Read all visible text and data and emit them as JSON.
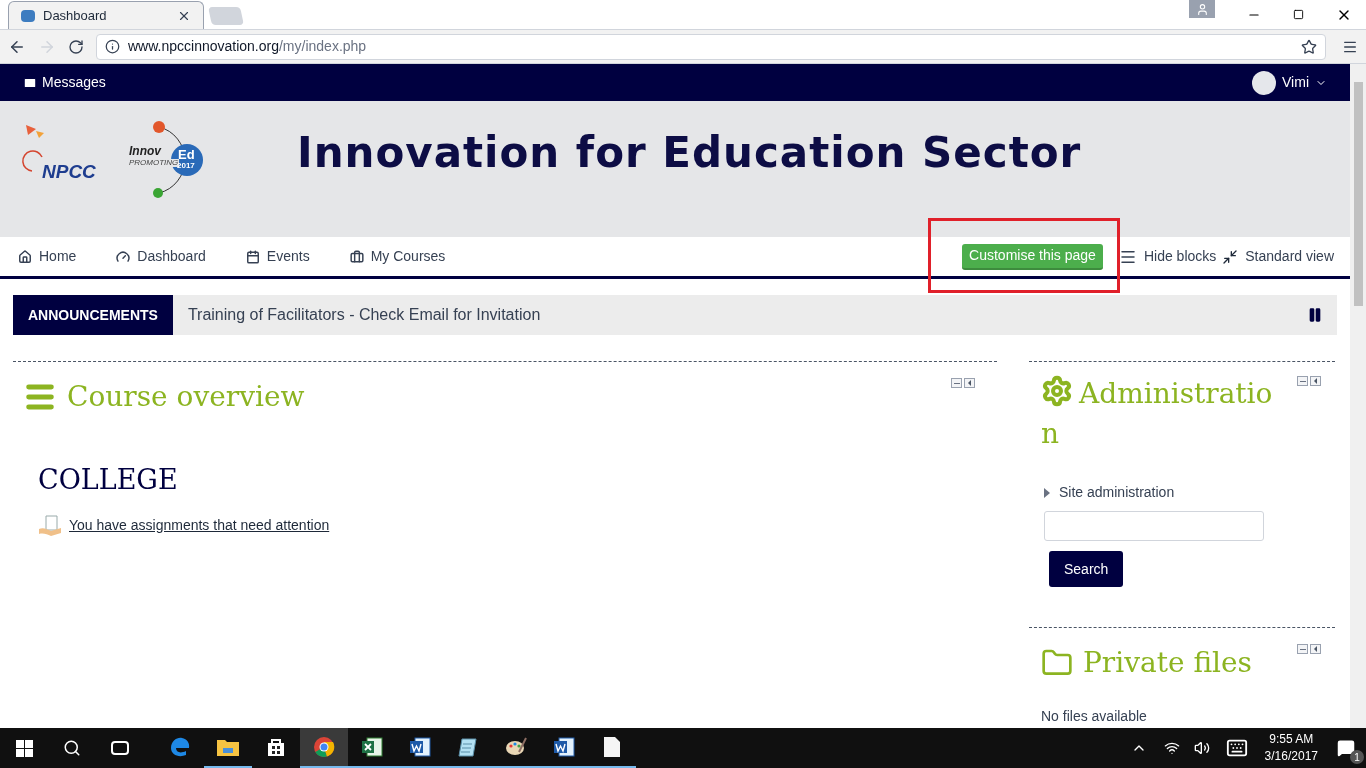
{
  "browser": {
    "tabs": [
      {
        "title": "Dashboard",
        "selected": true
      }
    ],
    "url_host": "www.npccinnovation.org",
    "url_path": "/my/index.php"
  },
  "topbar": {
    "messages": "Messages",
    "user": "Vimi"
  },
  "banner": {
    "npcc": "NPCC",
    "innov": "Innov",
    "promoting": "PROMOTING",
    "ed": "Ed",
    "year": "2017",
    "title": "Innovation for Education Sector"
  },
  "menu": [
    {
      "label": "Home",
      "kind": "home"
    },
    {
      "label": "Dashboard",
      "kind": "dashboard"
    },
    {
      "label": "Events",
      "kind": "calendar"
    },
    {
      "label": "My Courses",
      "kind": "briefcase"
    }
  ],
  "page_actions": {
    "customise": "Customise this page",
    "hide_blocks": "Hide blocks",
    "standard_view": "Standard view"
  },
  "announcements": {
    "label": "ANNOUNCEMENTS",
    "text": "Training of Facilitators - Check Email for Invitation"
  },
  "course_overview": {
    "title": "Course overview",
    "category": "COLLEGE",
    "notice": "You have assignments that need attention"
  },
  "administration": {
    "title_line1": "Administratio",
    "title_line2": "n",
    "item": "Site administration",
    "expanded": false,
    "search_button": "Search"
  },
  "private_files": {
    "title": "Private files",
    "text": "No files available"
  },
  "taskbar": {
    "apps": [
      {
        "kind": "edge",
        "running": false,
        "selected": false
      },
      {
        "kind": "explorer",
        "running": true,
        "selected": false
      },
      {
        "kind": "store",
        "running": false,
        "selected": false
      },
      {
        "kind": "chrome",
        "running": true,
        "selected": true
      },
      {
        "kind": "excel",
        "running": true,
        "selected": false
      },
      {
        "kind": "word",
        "running": true,
        "selected": false
      },
      {
        "kind": "notepad",
        "running": true,
        "selected": false
      },
      {
        "kind": "paint",
        "running": true,
        "selected": false
      },
      {
        "kind": "word",
        "running": true,
        "selected": false
      },
      {
        "kind": "file",
        "running": true,
        "selected": false
      }
    ],
    "time": "9:55 AM",
    "date": "3/16/2017",
    "notifications": "1"
  }
}
